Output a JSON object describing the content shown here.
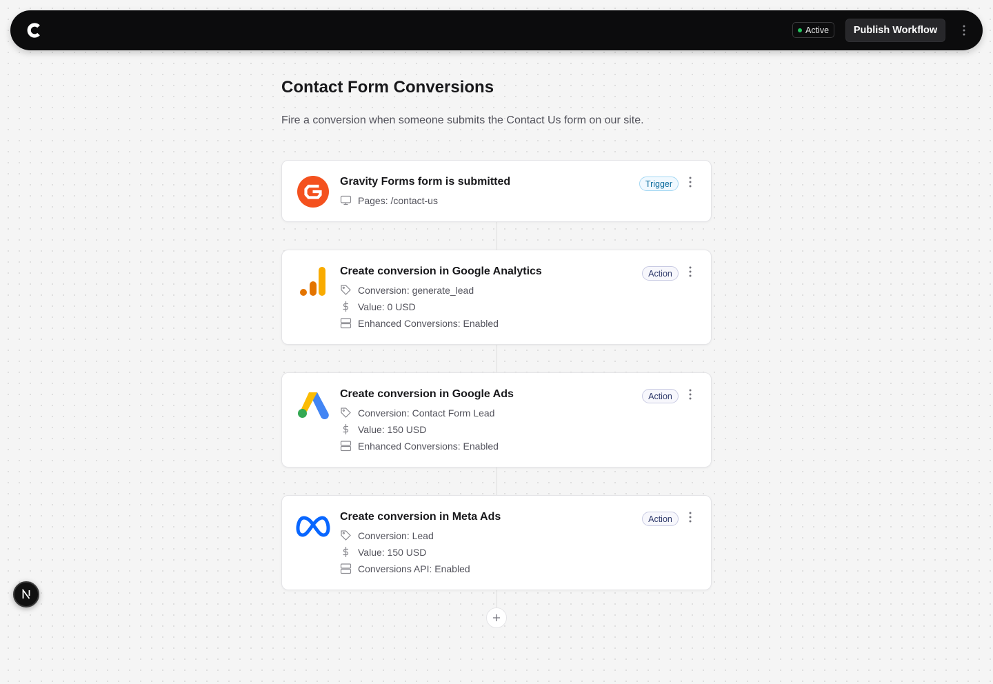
{
  "header": {
    "logo_icon": "c-logo-icon",
    "status_label": "Active",
    "status_color": "#22c55e",
    "publish_label": "Publish Workflow",
    "menu_icon": "vertical-dots-icon"
  },
  "workflow": {
    "title": "Contact Form Conversions",
    "description": "Fire a conversion when someone submits the Contact Us form on our site."
  },
  "steps": [
    {
      "icon": "gravity-forms-icon",
      "title": "Gravity Forms form is submitted",
      "badge": "Trigger",
      "details": [
        {
          "icon": "monitor-icon",
          "text": "Pages: /contact-us"
        }
      ]
    },
    {
      "icon": "google-analytics-icon",
      "title": "Create conversion in Google Analytics",
      "badge": "Action",
      "details": [
        {
          "icon": "tag-icon",
          "text": "Conversion: generate_lead"
        },
        {
          "icon": "dollar-icon",
          "text": "Value: 0 USD"
        },
        {
          "icon": "server-icon",
          "text": "Enhanced Conversions: Enabled"
        }
      ]
    },
    {
      "icon": "google-ads-icon",
      "title": "Create conversion in Google Ads",
      "badge": "Action",
      "details": [
        {
          "icon": "tag-icon",
          "text": "Conversion: Contact Form Lead"
        },
        {
          "icon": "dollar-icon",
          "text": "Value: 150 USD"
        },
        {
          "icon": "server-icon",
          "text": "Enhanced Conversions: Enabled"
        }
      ]
    },
    {
      "icon": "meta-icon",
      "title": "Create conversion in Meta Ads",
      "badge": "Action",
      "details": [
        {
          "icon": "tag-icon",
          "text": "Conversion: Lead"
        },
        {
          "icon": "dollar-icon",
          "text": "Value: 150 USD"
        },
        {
          "icon": "server-icon",
          "text": "Conversions API: Enabled"
        }
      ]
    }
  ],
  "add_step_icon": "plus-icon",
  "dev_tools_icon": "n-logo-icon"
}
